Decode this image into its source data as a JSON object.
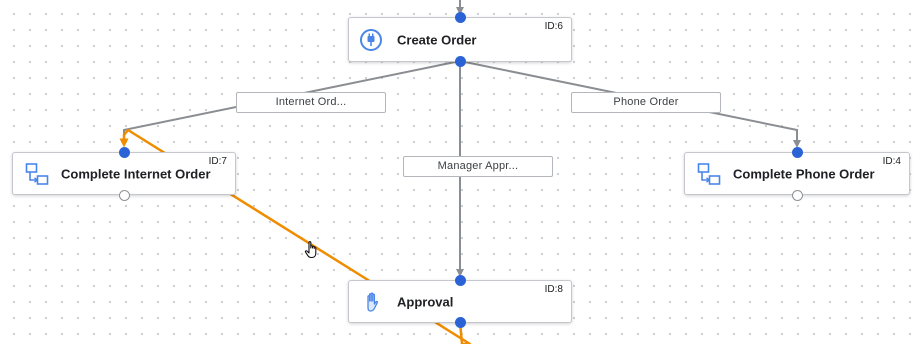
{
  "nodes": {
    "create_order": {
      "id_label": "ID:6",
      "title": "Create Order",
      "icon": "plug-icon"
    },
    "complete_internet_order": {
      "id_label": "ID:7",
      "title": "Complete Internet Order",
      "icon": "subprocess-icon"
    },
    "complete_phone_order": {
      "id_label": "ID:4",
      "title": "Complete Phone Order",
      "icon": "subprocess-icon"
    },
    "approval": {
      "id_label": "ID:8",
      "title": "Approval",
      "icon": "hand-icon"
    }
  },
  "edge_labels": {
    "internet_order": "Internet Ord...",
    "phone_order": "Phone Order",
    "manager_approval": "Manager Appr..."
  },
  "colors": {
    "port": "#2b63d6",
    "edge": "#8a8d91",
    "highlight_edge": "#f08c00",
    "icon_blue": "#4a86e8"
  },
  "cursor": "hand-pointer-icon"
}
